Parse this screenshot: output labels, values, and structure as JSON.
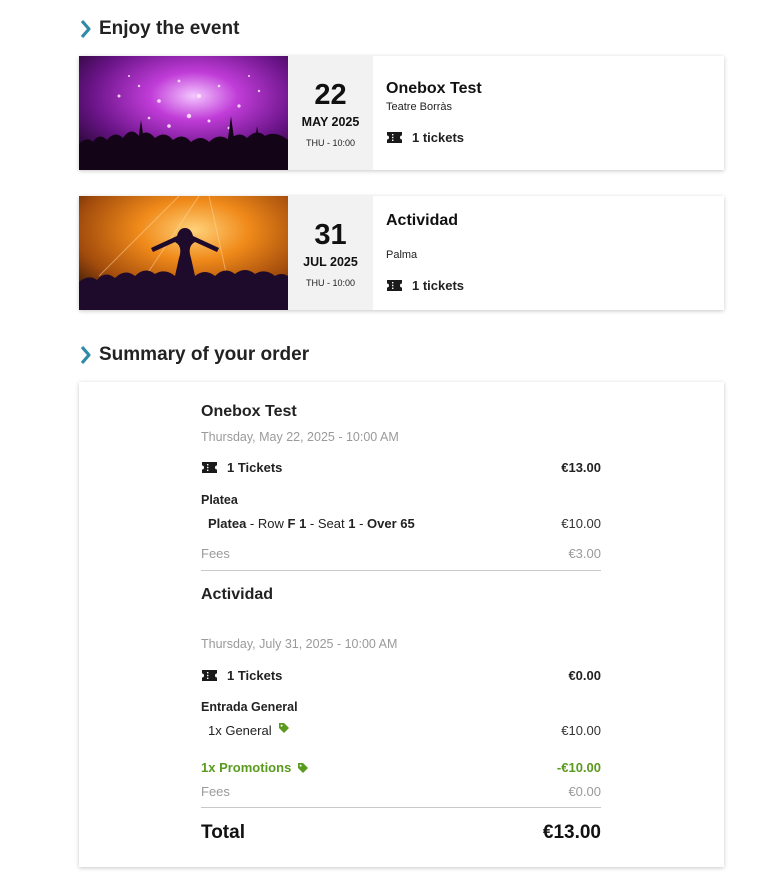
{
  "sections": {
    "enjoy_title": "Enjoy the event",
    "summary_title": "Summary of your order"
  },
  "events": [
    {
      "day": "22",
      "month_year": "MAY 2025",
      "dow_time": "THU - 10:00",
      "name": "Onebox Test",
      "venue": "Teatre Borràs",
      "tickets": "1 tickets"
    },
    {
      "day": "31",
      "month_year": "JUL 2025",
      "dow_time": "THU - 10:00",
      "name": "Actividad",
      "venue": "Palma",
      "tickets": "1 tickets"
    }
  ],
  "order": {
    "items": [
      {
        "event": "Onebox Test",
        "date": "Thursday, May 22, 2025 - 10:00 AM",
        "tickets_label": "1 Tickets",
        "tickets_total": "€13.00",
        "zone": "Platea",
        "line": {
          "zone": "Platea",
          "row_label": "Row",
          "row": "F 1",
          "seat_label": "Seat",
          "seat": "1",
          "rate": "Over 65",
          "price": "€10.00"
        },
        "fees_label": "Fees",
        "fees": "€3.00"
      },
      {
        "event": "Actividad",
        "date": "Thursday, July 31, 2025 - 10:00 AM",
        "tickets_label": "1 Tickets",
        "tickets_total": "€0.00",
        "zone": "Entrada General",
        "line": {
          "label": "1x General",
          "price": "€10.00"
        },
        "promo_label": "1x Promotions",
        "promo": "-€10.00",
        "fees_label": "Fees",
        "fees": "€0.00"
      }
    ],
    "total_label": "Total",
    "total": "€13.00"
  },
  "colors": {
    "accent_chevron": "#2e8aa8",
    "promo_green": "#5a9a1e"
  },
  "icons": [
    "chevron-right-icon",
    "ticket-icon",
    "tag-icon"
  ]
}
